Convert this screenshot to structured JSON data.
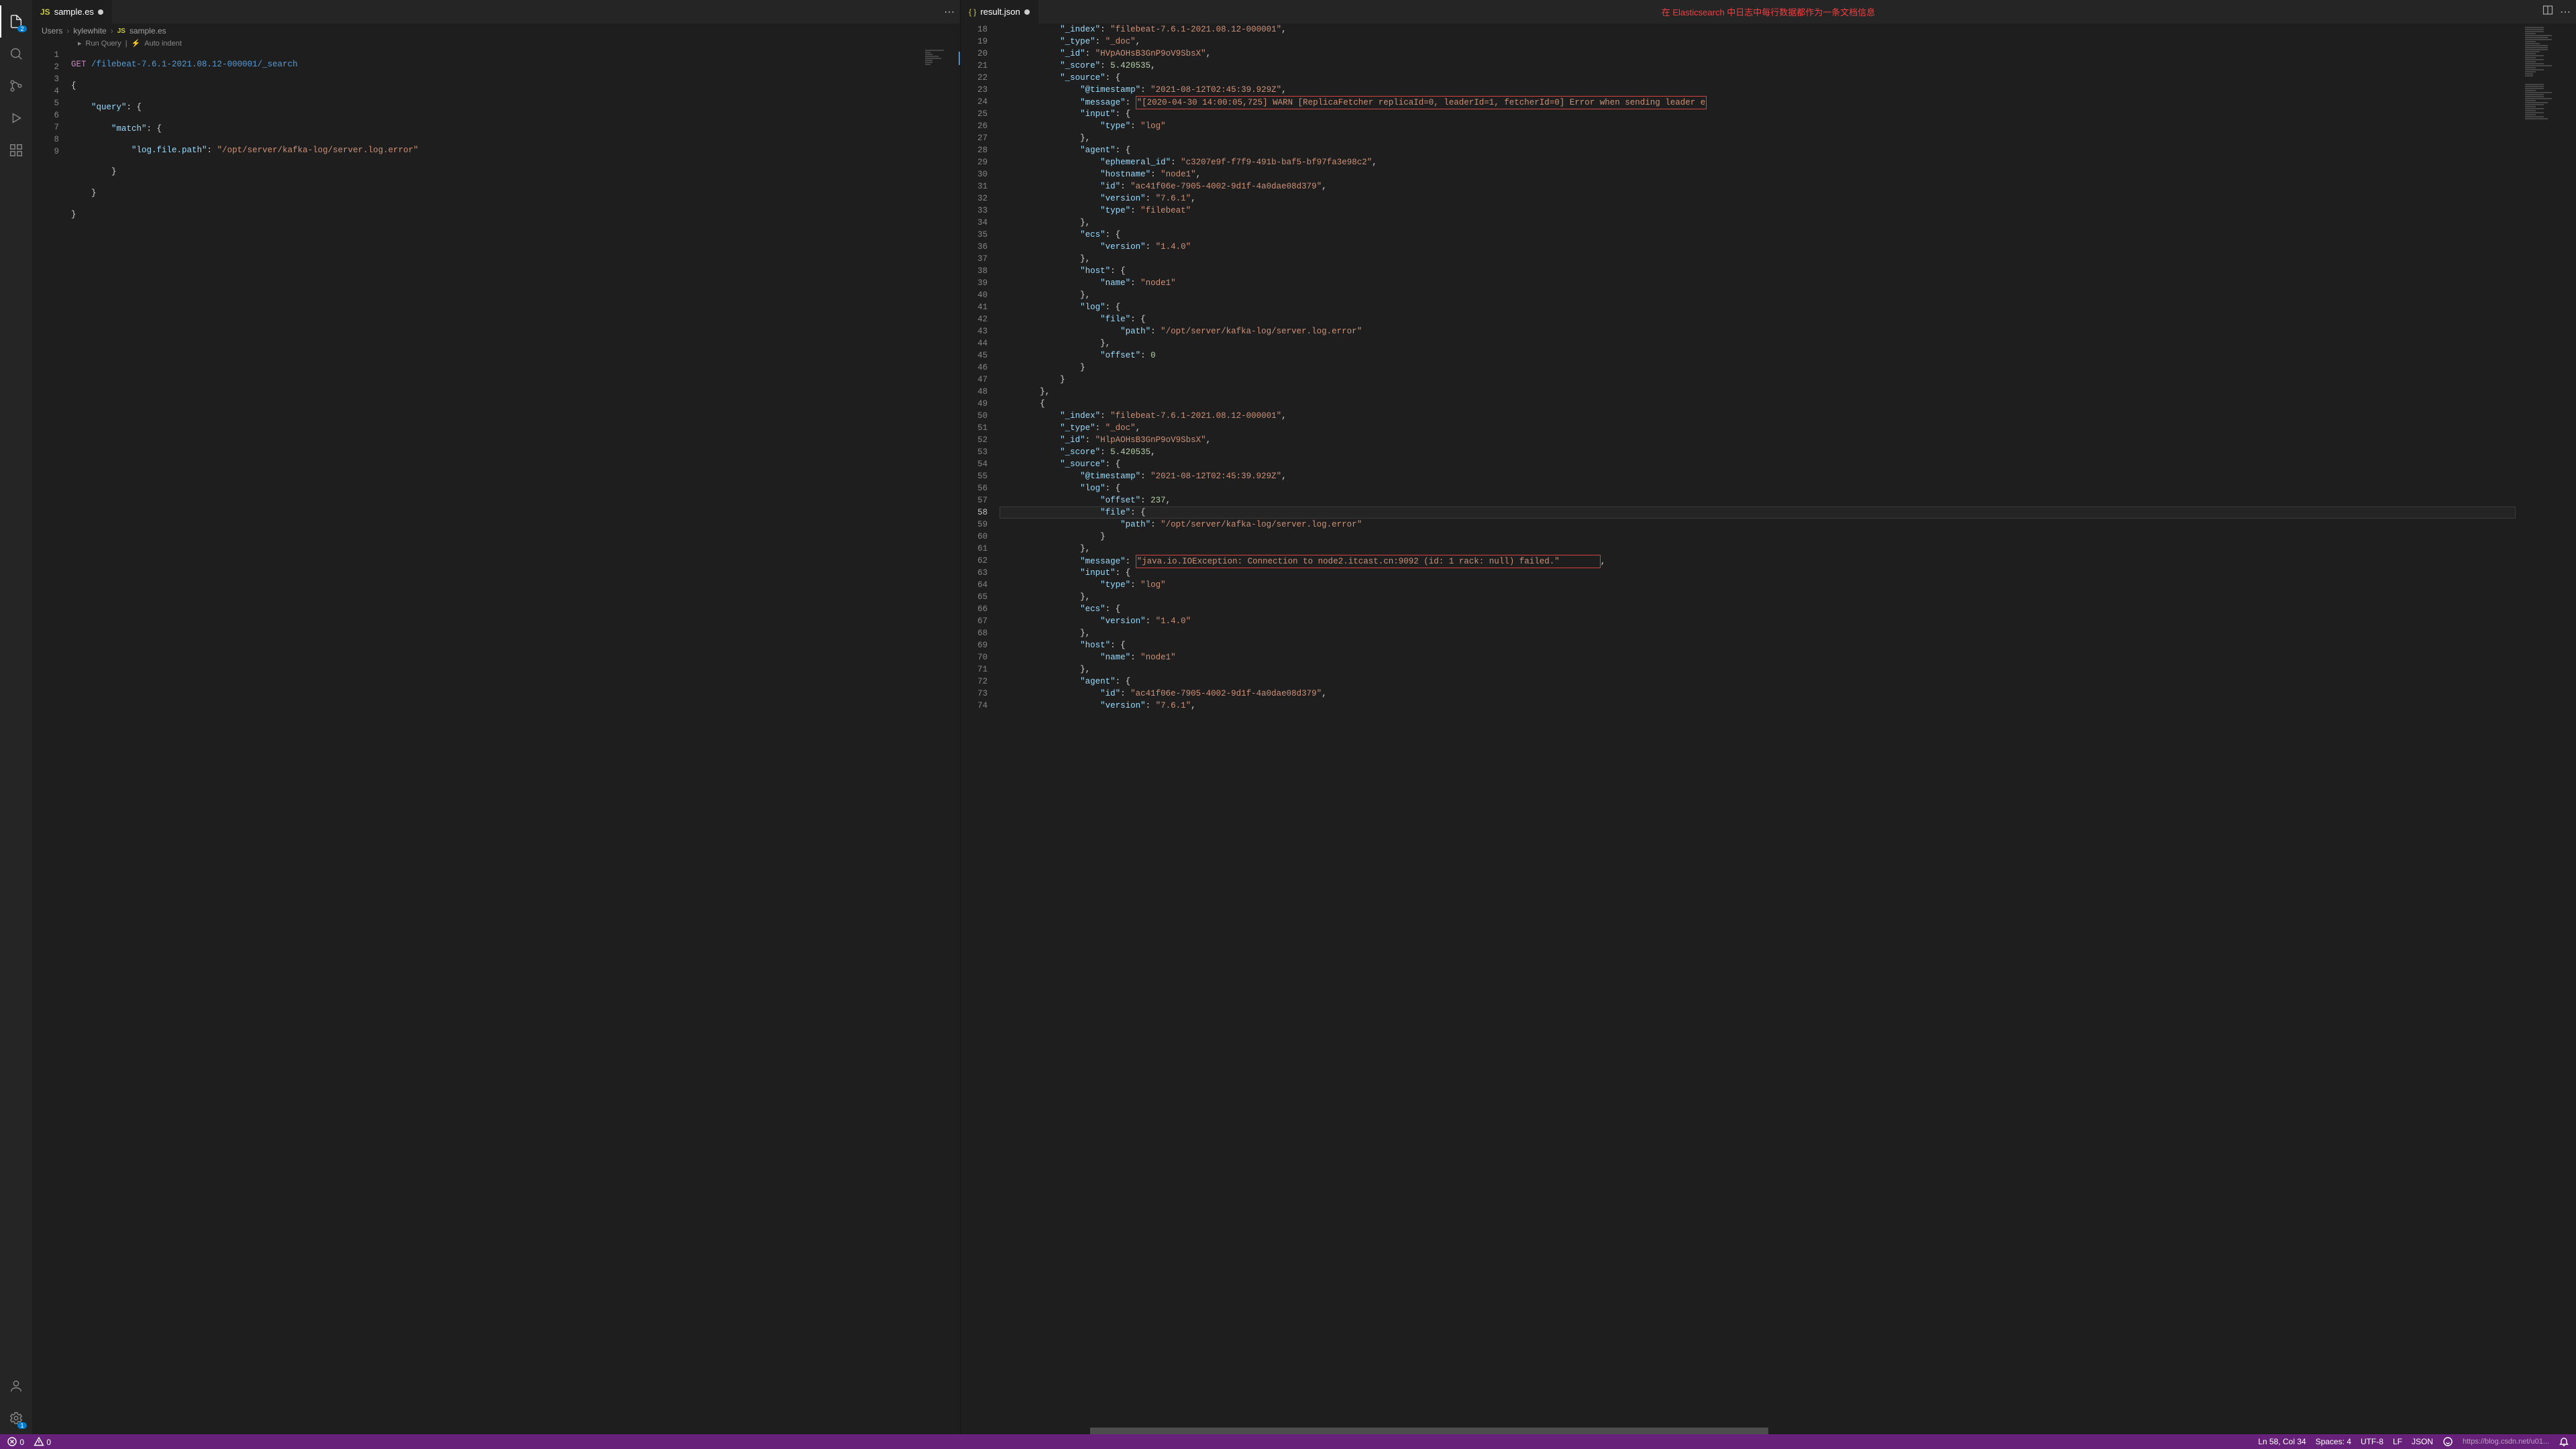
{
  "tabs_left": {
    "name": "sample.es"
  },
  "tabs_right": {
    "name": "result.json"
  },
  "top_message": "在 Elasticsearch 中日志中每行数据都作为一条文档信息",
  "breadcrumb": {
    "p0": "Users",
    "p1": "kylewhite",
    "p2": "sample.es"
  },
  "codelens": {
    "run": "Run Query",
    "auto": "Auto indent"
  },
  "left_code": {
    "l1a": "GET",
    "l1b": "/filebeat-7.6.1-2021.08.12-000001/_search",
    "l2": "{",
    "l3a": "\"query\"",
    "l3b": ": {",
    "l4a": "\"match\"",
    "l4b": ": {",
    "l5a": "\"log.file.path\"",
    "l5b": ": ",
    "l5c": "\"/opt/server/kafka-log/server.log.error\"",
    "l6": "}",
    "l7": "}",
    "l8": "}"
  },
  "rlines": {
    "18": [
      [
        "k",
        "\"_index\""
      ],
      [
        "p",
        ": "
      ],
      [
        "s",
        "\"filebeat-7.6.1-2021.08.12-000001\""
      ],
      [
        "p",
        ","
      ]
    ],
    "19": [
      [
        "k",
        "\"_type\""
      ],
      [
        "p",
        ": "
      ],
      [
        "s",
        "\"_doc\""
      ],
      [
        "p",
        ","
      ]
    ],
    "20": [
      [
        "k",
        "\"_id\""
      ],
      [
        "p",
        ": "
      ],
      [
        "s",
        "\"HVpAOHsB3GnP9oV9SbsX\""
      ],
      [
        "p",
        ","
      ]
    ],
    "21": [
      [
        "k",
        "\"_score\""
      ],
      [
        "p",
        ": "
      ],
      [
        "n",
        "5.420535"
      ],
      [
        "p",
        ","
      ]
    ],
    "22": [
      [
        "k",
        "\"_source\""
      ],
      [
        "p",
        ": {"
      ]
    ],
    "23": [
      [
        "k",
        "\"@timestamp\""
      ],
      [
        "p",
        ": "
      ],
      [
        "s",
        "\"2021-08-12T02:45:39.929Z\""
      ],
      [
        "p",
        ","
      ]
    ],
    "24a": [
      [
        "k",
        "\"message\""
      ],
      [
        "p",
        ": "
      ]
    ],
    "24b": "\"[2020-04-30 14:00:05,725] WARN [ReplicaFetcher replicaId=0, leaderId=1, fetcherId=0] Error when sending leader e",
    "25": [
      [
        "k",
        "\"input\""
      ],
      [
        "p",
        ": {"
      ]
    ],
    "26": [
      [
        "k",
        "\"type\""
      ],
      [
        "p",
        ": "
      ],
      [
        "s",
        "\"log\""
      ]
    ],
    "27": [
      [
        "p",
        "},"
      ]
    ],
    "28": [
      [
        "k",
        "\"agent\""
      ],
      [
        "p",
        ": {"
      ]
    ],
    "29": [
      [
        "k",
        "\"ephemeral_id\""
      ],
      [
        "p",
        ": "
      ],
      [
        "s",
        "\"c3207e9f-f7f9-491b-baf5-bf97fa3e98c2\""
      ],
      [
        "p",
        ","
      ]
    ],
    "30": [
      [
        "k",
        "\"hostname\""
      ],
      [
        "p",
        ": "
      ],
      [
        "s",
        "\"node1\""
      ],
      [
        "p",
        ","
      ]
    ],
    "31": [
      [
        "k",
        "\"id\""
      ],
      [
        "p",
        ": "
      ],
      [
        "s",
        "\"ac41f06e-7905-4002-9d1f-4a0dae08d379\""
      ],
      [
        "p",
        ","
      ]
    ],
    "32": [
      [
        "k",
        "\"version\""
      ],
      [
        "p",
        ": "
      ],
      [
        "s",
        "\"7.6.1\""
      ],
      [
        "p",
        ","
      ]
    ],
    "33": [
      [
        "k",
        "\"type\""
      ],
      [
        "p",
        ": "
      ],
      [
        "s",
        "\"filebeat\""
      ]
    ],
    "34": [
      [
        "p",
        "},"
      ]
    ],
    "35": [
      [
        "k",
        "\"ecs\""
      ],
      [
        "p",
        ": {"
      ]
    ],
    "36": [
      [
        "k",
        "\"version\""
      ],
      [
        "p",
        ": "
      ],
      [
        "s",
        "\"1.4.0\""
      ]
    ],
    "37": [
      [
        "p",
        "},"
      ]
    ],
    "38": [
      [
        "k",
        "\"host\""
      ],
      [
        "p",
        ": {"
      ]
    ],
    "39": [
      [
        "k",
        "\"name\""
      ],
      [
        "p",
        ": "
      ],
      [
        "s",
        "\"node1\""
      ]
    ],
    "40": [
      [
        "p",
        "},"
      ]
    ],
    "41": [
      [
        "k",
        "\"log\""
      ],
      [
        "p",
        ": {"
      ]
    ],
    "42": [
      [
        "k",
        "\"file\""
      ],
      [
        "p",
        ": {"
      ]
    ],
    "43": [
      [
        "k",
        "\"path\""
      ],
      [
        "p",
        ": "
      ],
      [
        "s",
        "\"/opt/server/kafka-log/server.log.error\""
      ]
    ],
    "44": [
      [
        "p",
        "},"
      ]
    ],
    "45": [
      [
        "k",
        "\"offset\""
      ],
      [
        "p",
        ": "
      ],
      [
        "n",
        "0"
      ]
    ],
    "46": [
      [
        "p",
        "}"
      ]
    ],
    "47": [
      [
        "p",
        "}"
      ]
    ],
    "48": [
      [
        "p",
        "},"
      ]
    ],
    "49": [
      [
        "p",
        "{"
      ]
    ],
    "50": [
      [
        "k",
        "\"_index\""
      ],
      [
        "p",
        ": "
      ],
      [
        "s",
        "\"filebeat-7.6.1-2021.08.12-000001\""
      ],
      [
        "p",
        ","
      ]
    ],
    "51": [
      [
        "k",
        "\"_type\""
      ],
      [
        "p",
        ": "
      ],
      [
        "s",
        "\"_doc\""
      ],
      [
        "p",
        ","
      ]
    ],
    "52": [
      [
        "k",
        "\"_id\""
      ],
      [
        "p",
        ": "
      ],
      [
        "s",
        "\"HlpAOHsB3GnP9oV9SbsX\""
      ],
      [
        "p",
        ","
      ]
    ],
    "53": [
      [
        "k",
        "\"_score\""
      ],
      [
        "p",
        ": "
      ],
      [
        "n",
        "5.420535"
      ],
      [
        "p",
        ","
      ]
    ],
    "54": [
      [
        "k",
        "\"_source\""
      ],
      [
        "p",
        ": {"
      ]
    ],
    "55": [
      [
        "k",
        "\"@timestamp\""
      ],
      [
        "p",
        ": "
      ],
      [
        "s",
        "\"2021-08-12T02:45:39.929Z\""
      ],
      [
        "p",
        ","
      ]
    ],
    "56": [
      [
        "k",
        "\"log\""
      ],
      [
        "p",
        ": {"
      ]
    ],
    "57": [
      [
        "k",
        "\"offset\""
      ],
      [
        "p",
        ": "
      ],
      [
        "n",
        "237"
      ],
      [
        "p",
        ","
      ]
    ],
    "58": [
      [
        "k",
        "\"file\""
      ],
      [
        "p",
        ": {"
      ]
    ],
    "59": [
      [
        "k",
        "\"path\""
      ],
      [
        "p",
        ": "
      ],
      [
        "s",
        "\"/opt/server/kafka-log/server.log.error\""
      ]
    ],
    "60": [
      [
        "p",
        "}"
      ]
    ],
    "61": [
      [
        "p",
        "},"
      ]
    ],
    "62a": [
      [
        "k",
        "\"message\""
      ],
      [
        "p",
        ": "
      ]
    ],
    "62b": "\"java.io.IOException: Connection to node2.itcast.cn:9092 (id: 1 rack: null) failed.\"",
    "62c": ",",
    "63": [
      [
        "k",
        "\"input\""
      ],
      [
        "p",
        ": {"
      ]
    ],
    "64": [
      [
        "k",
        "\"type\""
      ],
      [
        "p",
        ": "
      ],
      [
        "s",
        "\"log\""
      ]
    ],
    "65": [
      [
        "p",
        "},"
      ]
    ],
    "66": [
      [
        "k",
        "\"ecs\""
      ],
      [
        "p",
        ": {"
      ]
    ],
    "67": [
      [
        "k",
        "\"version\""
      ],
      [
        "p",
        ": "
      ],
      [
        "s",
        "\"1.4.0\""
      ]
    ],
    "68": [
      [
        "p",
        "},"
      ]
    ],
    "69": [
      [
        "k",
        "\"host\""
      ],
      [
        "p",
        ": {"
      ]
    ],
    "70": [
      [
        "k",
        "\"name\""
      ],
      [
        "p",
        ": "
      ],
      [
        "s",
        "\"node1\""
      ]
    ],
    "71": [
      [
        "p",
        "},"
      ]
    ],
    "72": [
      [
        "k",
        "\"agent\""
      ],
      [
        "p",
        ": {"
      ]
    ],
    "73": [
      [
        "k",
        "\"id\""
      ],
      [
        "p",
        ": "
      ],
      [
        "s",
        "\"ac41f06e-7905-4002-9d1f-4a0dae08d379\""
      ],
      [
        "p",
        ","
      ]
    ],
    "74": [
      [
        "k",
        "\"version\""
      ],
      [
        "p",
        ": "
      ],
      [
        "s",
        "\"7.6.1\""
      ],
      [
        "p",
        ","
      ]
    ]
  },
  "indent": {
    "18": 3,
    "19": 3,
    "20": 3,
    "21": 3,
    "22": 3,
    "23": 4,
    "24": 4,
    "25": 4,
    "26": 5,
    "27": 4,
    "28": 4,
    "29": 5,
    "30": 5,
    "31": 5,
    "32": 5,
    "33": 5,
    "34": 4,
    "35": 4,
    "36": 5,
    "37": 4,
    "38": 4,
    "39": 5,
    "40": 4,
    "41": 4,
    "42": 5,
    "43": 6,
    "44": 5,
    "45": 5,
    "46": 4,
    "47": 3,
    "48": 2,
    "49": 2,
    "50": 3,
    "51": 3,
    "52": 3,
    "53": 3,
    "54": 3,
    "55": 4,
    "56": 4,
    "57": 5,
    "58": 5,
    "59": 6,
    "60": 5,
    "61": 4,
    "62": 4,
    "63": 4,
    "64": 5,
    "65": 4,
    "66": 4,
    "67": 5,
    "68": 4,
    "69": 4,
    "70": 5,
    "71": 4,
    "72": 4,
    "73": 5,
    "74": 5
  },
  "status": {
    "errors": "0",
    "warnings": "0",
    "lncol": "Ln 58, Col 34",
    "spaces": "Spaces: 4",
    "enc": "UTF-8",
    "eol": "LF",
    "lang": "JSON",
    "watermark": "https://blog.csdn.net/u01..."
  },
  "badge": {
    "files": "2",
    "gear": "1"
  }
}
